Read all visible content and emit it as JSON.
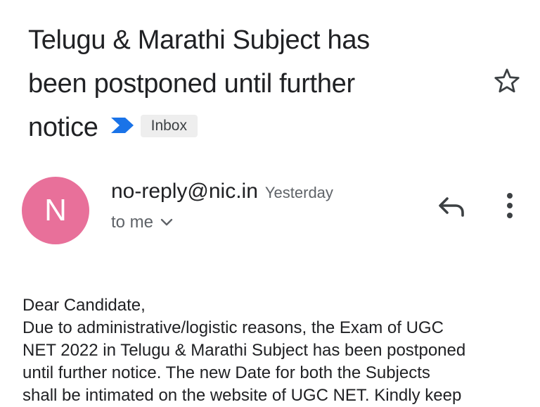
{
  "email": {
    "subject_lines": [
      "Telugu & Marathi Subject has",
      "been postponed until further",
      "notice"
    ],
    "label": "Inbox",
    "importance_color": "#1a73e8",
    "starred": false
  },
  "sender": {
    "initial": "N",
    "avatar_color": "#e8709a",
    "address": "no-reply@nic.in",
    "time": "Yesterday",
    "recipient": "to me"
  },
  "icons": {
    "star": "star-outline-icon",
    "reply": "reply-icon",
    "more": "more-vert-icon",
    "recipient_details": "chevron-down-icon",
    "importance": "importance-marker-icon"
  },
  "body": {
    "lines": [
      "Dear Candidate,",
      "Due to administrative/logistic reasons, the Exam of UGC",
      "NET 2022 in Telugu & Marathi Subject has been postponed",
      "until further notice. The new Date for both the Subjects",
      "shall be intimated on the website of UGC NET. Kindly keep"
    ]
  }
}
